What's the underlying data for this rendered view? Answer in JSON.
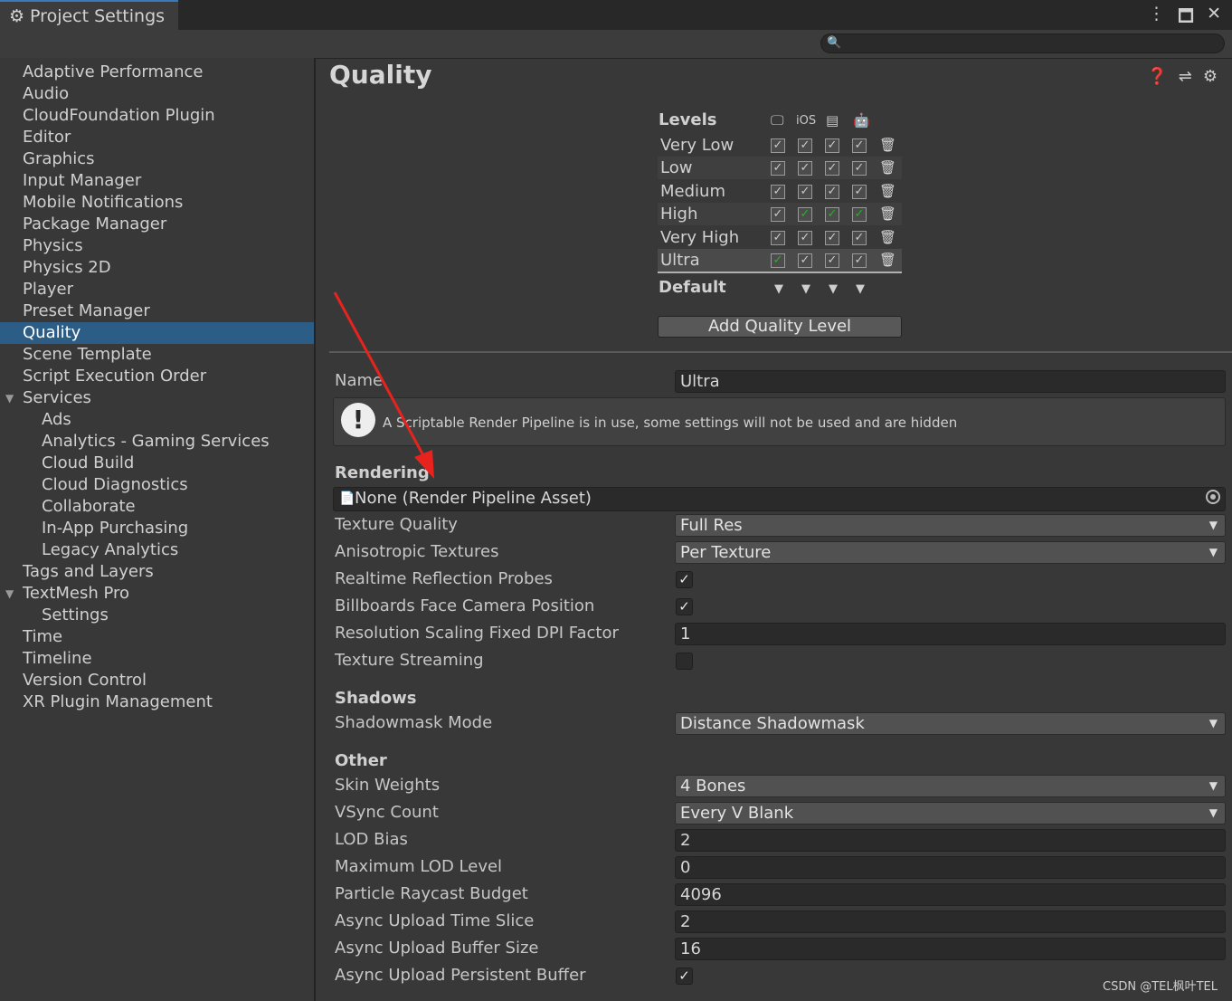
{
  "window": {
    "tab_title": "Project Settings",
    "tab_icon": "gear-icon",
    "controls": [
      "more-icon",
      "maximize-icon",
      "close-icon"
    ]
  },
  "search": {
    "icon": "search-icon",
    "value": ""
  },
  "sidebar": {
    "items": [
      {
        "label": "Adaptive Performance"
      },
      {
        "label": "Audio"
      },
      {
        "label": "CloudFoundation Plugin"
      },
      {
        "label": "Editor"
      },
      {
        "label": "Graphics"
      },
      {
        "label": "Input Manager"
      },
      {
        "label": "Mobile Notifications"
      },
      {
        "label": "Package Manager"
      },
      {
        "label": "Physics"
      },
      {
        "label": "Physics 2D"
      },
      {
        "label": "Player"
      },
      {
        "label": "Preset Manager"
      },
      {
        "label": "Quality",
        "selected": true
      },
      {
        "label": "Scene Template"
      },
      {
        "label": "Script Execution Order"
      },
      {
        "label": "Services",
        "expanded": true
      },
      {
        "label": "Ads",
        "child": true
      },
      {
        "label": "Analytics - Gaming Services",
        "child": true
      },
      {
        "label": "Cloud Build",
        "child": true
      },
      {
        "label": "Cloud Diagnostics",
        "child": true
      },
      {
        "label": "Collaborate",
        "child": true
      },
      {
        "label": "In-App Purchasing",
        "child": true
      },
      {
        "label": "Legacy Analytics",
        "child": true
      },
      {
        "label": "Tags and Layers"
      },
      {
        "label": "TextMesh Pro",
        "expanded": true
      },
      {
        "label": "Settings",
        "child": true
      },
      {
        "label": "Time"
      },
      {
        "label": "Timeline"
      },
      {
        "label": "Version Control"
      },
      {
        "label": "XR Plugin Management"
      }
    ]
  },
  "main": {
    "title": "Quality",
    "header_icons": [
      "help-icon",
      "presets-icon",
      "settings-icon"
    ],
    "levels": {
      "label": "Levels",
      "platforms": [
        {
          "name": "standalone-icon",
          "text": ""
        },
        {
          "name": "ios-icon",
          "text": "iOS"
        },
        {
          "name": "webgl-icon",
          "text": ""
        },
        {
          "name": "android-icon",
          "text": ""
        }
      ],
      "rows": [
        {
          "name": "Very Low",
          "checks": [
            true,
            true,
            true,
            true
          ],
          "default_for": [
            false,
            false,
            false,
            false
          ]
        },
        {
          "name": "Low",
          "checks": [
            true,
            true,
            true,
            true
          ],
          "default_for": [
            false,
            false,
            false,
            false
          ]
        },
        {
          "name": "Medium",
          "checks": [
            true,
            true,
            true,
            true
          ],
          "default_for": [
            false,
            false,
            false,
            false
          ]
        },
        {
          "name": "High",
          "checks": [
            true,
            true,
            true,
            true
          ],
          "default_for": [
            false,
            true,
            true,
            true
          ]
        },
        {
          "name": "Very High",
          "checks": [
            true,
            true,
            true,
            true
          ],
          "default_for": [
            false,
            false,
            false,
            false
          ]
        },
        {
          "name": "Ultra",
          "checks": [
            true,
            true,
            true,
            true
          ],
          "default_for": [
            true,
            false,
            false,
            false
          ],
          "selected": true
        }
      ],
      "default_label": "Default",
      "add_button": "Add Quality Level"
    },
    "name_label": "Name",
    "name_value": "Ultra",
    "warning": "A Scriptable Render Pipeline is in use, some settings will not be used and are hidden",
    "rendering": {
      "section": "Rendering",
      "pipeline_asset": "None (Render Pipeline Asset)",
      "texture_quality": {
        "label": "Texture Quality",
        "value": "Full Res"
      },
      "anisotropic": {
        "label": "Anisotropic Textures",
        "value": "Per Texture"
      },
      "reflection_probes": {
        "label": "Realtime Reflection Probes",
        "checked": true
      },
      "billboards": {
        "label": "Billboards Face Camera Position",
        "checked": true
      },
      "dpi_factor": {
        "label": "Resolution Scaling Fixed DPI Factor",
        "value": "1"
      },
      "texture_streaming": {
        "label": "Texture Streaming",
        "checked": false
      }
    },
    "shadows": {
      "section": "Shadows",
      "shadowmask": {
        "label": "Shadowmask Mode",
        "value": "Distance Shadowmask"
      }
    },
    "other": {
      "section": "Other",
      "skin_weights": {
        "label": "Skin Weights",
        "value": "4 Bones"
      },
      "vsync": {
        "label": "VSync Count",
        "value": "Every V Blank"
      },
      "lod_bias": {
        "label": "LOD Bias",
        "value": "2"
      },
      "max_lod": {
        "label": "Maximum LOD Level",
        "value": "0"
      },
      "raycast_budget": {
        "label": "Particle Raycast Budget",
        "value": "4096"
      },
      "upload_time": {
        "label": "Async Upload Time Slice",
        "value": "2"
      },
      "upload_buffer": {
        "label": "Async Upload Buffer Size",
        "value": "16"
      },
      "persistent_buffer": {
        "label": "Async Upload Persistent Buffer",
        "checked": true
      }
    }
  },
  "watermark": "CSDN @TEL枫叶TEL",
  "colors": {
    "accent": "#2c5d87",
    "default_check": "#22b522",
    "annotation_arrow": "#e8231d"
  }
}
